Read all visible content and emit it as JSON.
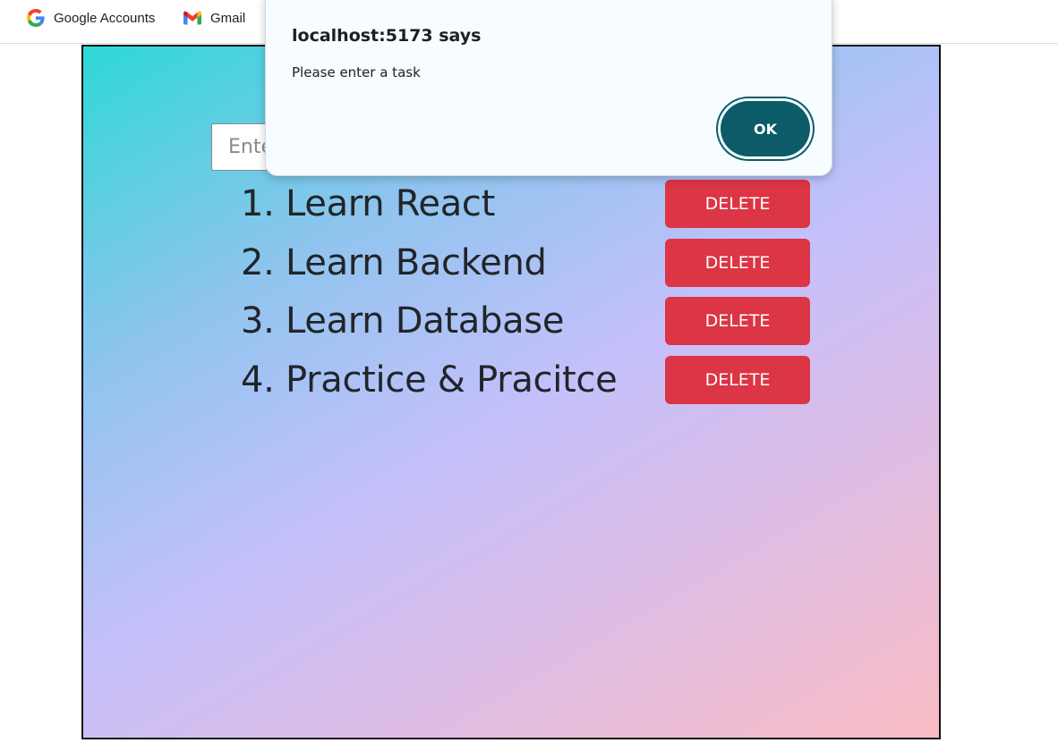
{
  "bookmarks": [
    {
      "label": "Google Accounts",
      "icon": "google-g-icon"
    },
    {
      "label": "Gmail",
      "icon": "gmail-icon"
    }
  ],
  "app": {
    "input": {
      "placeholder": "Enter a task...",
      "value": ""
    },
    "tasks": [
      {
        "text": "1. Learn React",
        "delete_label": "DELETE"
      },
      {
        "text": "2. Learn Backend",
        "delete_label": "DELETE"
      },
      {
        "text": "3. Learn Database",
        "delete_label": "DELETE"
      },
      {
        "text": "4. Practice & Pracitce",
        "delete_label": "DELETE"
      }
    ],
    "colors": {
      "gradient_start": "#2ed8d8",
      "gradient_mid": "#c5c0fb",
      "gradient_end": "#f9bcc4",
      "delete_button": "#dc3545",
      "text": "#212529"
    }
  },
  "alert": {
    "title": "localhost:5173 says",
    "message": "Please enter a task",
    "ok_label": "OK",
    "colors": {
      "ok_button": "#0b5c68",
      "background": "#f6fcff"
    }
  }
}
